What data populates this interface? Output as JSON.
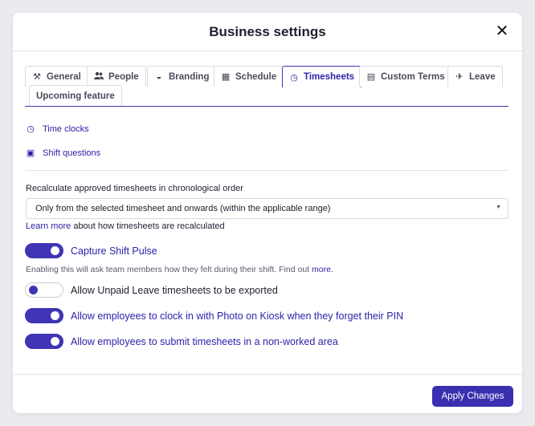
{
  "modal": {
    "title": "Business settings",
    "close_glyph": "✕"
  },
  "tabs": [
    {
      "label": "General",
      "icon": "tools-icon",
      "glyph": "⚒"
    },
    {
      "label": "People",
      "icon": "people-icon",
      "glyph": "👥"
    },
    {
      "label": "Branding",
      "icon": "paint-icon",
      "glyph": "◒"
    },
    {
      "label": "Schedule",
      "icon": "calendar-icon",
      "glyph": "▦"
    },
    {
      "label": "Timesheets",
      "icon": "clock-icon",
      "glyph": "◷",
      "active": true
    },
    {
      "label": "Custom Terms",
      "icon": "book-icon",
      "glyph": "▤"
    },
    {
      "label": "Leave",
      "icon": "plane-icon",
      "glyph": "✈"
    },
    {
      "label": "Upcoming feature",
      "icon": "",
      "glyph": ""
    }
  ],
  "links": {
    "time_clocks": {
      "label": "Time clocks",
      "glyph": "◷"
    },
    "shift_questions": {
      "label": "Shift questions",
      "glyph": "▣"
    }
  },
  "recalc": {
    "label": "Recalculate approved timesheets in chronological order",
    "selected": "Only from the selected timesheet and onwards (within the applicable range)",
    "learn_link": "Learn more",
    "learn_rest": " about how timesheets are recalculated"
  },
  "toggles": {
    "shift_pulse": {
      "label": "Capture Shift Pulse",
      "on": true
    },
    "shift_pulse_help": "Enabling this will ask team members how they felt during their shift. Find out ",
    "shift_pulse_help_link": "more.",
    "unpaid_leave": {
      "label": "Allow Unpaid Leave timesheets to be exported",
      "on": false
    },
    "photo_kiosk": {
      "label": "Allow employees to clock in with Photo on Kiosk when they forget their PIN",
      "on": true
    },
    "non_worked": {
      "label": "Allow employees to submit timesheets in a non-worked area",
      "on": true
    }
  },
  "footer": {
    "apply_label": "Apply Changes"
  },
  "colors": {
    "accent": "#3f35b4",
    "link": "#2d22a8",
    "background": "#ebebef"
  }
}
